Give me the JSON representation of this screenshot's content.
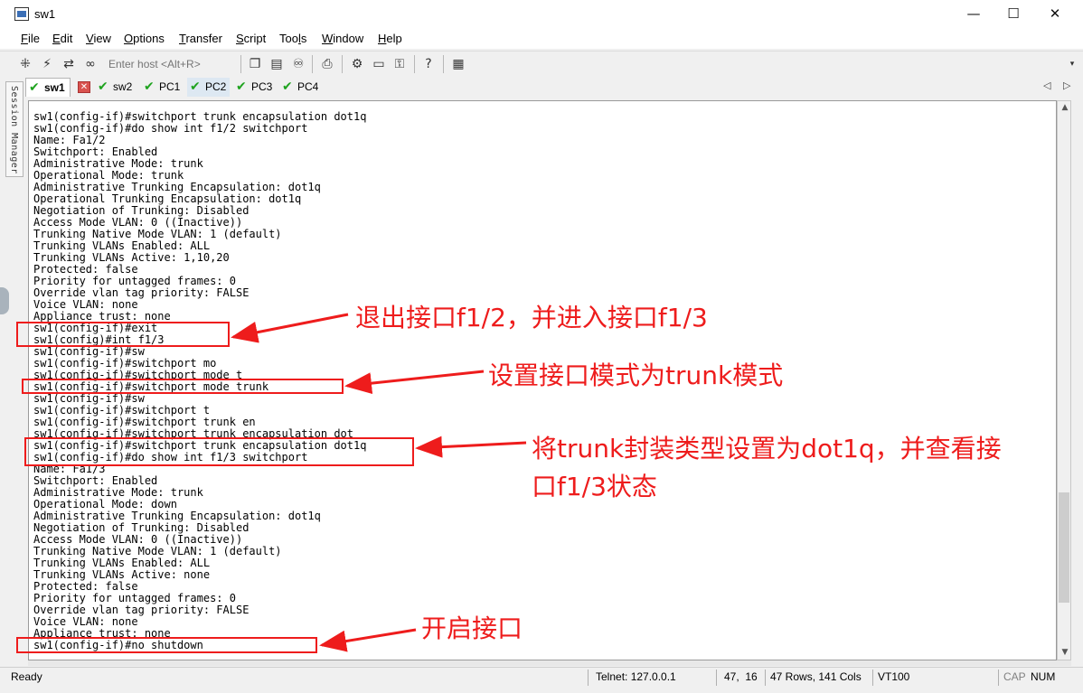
{
  "window": {
    "title": "sw1",
    "minimize_glyph": "—",
    "maximize_glyph": "☐",
    "close_glyph": "✕"
  },
  "menu": {
    "items": [
      {
        "accel": "F",
        "rest": "ile"
      },
      {
        "accel": "E",
        "rest": "dit"
      },
      {
        "accel": "V",
        "rest": "iew"
      },
      {
        "accel": "O",
        "rest": "ptions"
      },
      {
        "accel": "T",
        "rest": "ransfer"
      },
      {
        "accel": "S",
        "rest": "cript"
      },
      {
        "pre": "Too",
        "accel": "l",
        "rest": "s"
      },
      {
        "accel": "W",
        "rest": "indow"
      },
      {
        "accel": "H",
        "rest": "elp"
      }
    ]
  },
  "toolbar": {
    "host_placeholder": "Enter host <Alt+R>",
    "icons": [
      "connect-icon",
      "lightning-icon",
      "reconnect-icon",
      "link-icon",
      "copy-icon",
      "paste-icon",
      "find-icon",
      "print-icon",
      "settings-icon",
      "keymap-icon",
      "key-icon",
      "help-icon",
      "sftp-icon"
    ]
  },
  "tabs": [
    {
      "label": "sw1",
      "active": true
    },
    {
      "label": "sw2"
    },
    {
      "label": "PC1"
    },
    {
      "label": "PC2"
    },
    {
      "label": "PC3"
    },
    {
      "label": "PC4"
    }
  ],
  "session_manager": "Session Manager",
  "terminal": {
    "lines": [
      "sw1(config-if)#switchport trunk encapsulation dot1q",
      "sw1(config-if)#do show int f1/2 switchport",
      "Name: Fa1/2",
      "Switchport: Enabled",
      "Administrative Mode: trunk",
      "Operational Mode: trunk",
      "Administrative Trunking Encapsulation: dot1q",
      "Operational Trunking Encapsulation: dot1q",
      "Negotiation of Trunking: Disabled",
      "Access Mode VLAN: 0 ((Inactive))",
      "Trunking Native Mode VLAN: 1 (default)",
      "Trunking VLANs Enabled: ALL",
      "Trunking VLANs Active: 1,10,20",
      "Protected: false",
      "Priority for untagged frames: 0",
      "Override vlan tag priority: FALSE",
      "Voice VLAN: none",
      "Appliance trust: none",
      "sw1(config-if)#exit",
      "sw1(config)#int f1/3",
      "sw1(config-if)#sw",
      "sw1(config-if)#switchport mo",
      "sw1(config-if)#switchport mode t",
      "sw1(config-if)#switchport mode trunk",
      "sw1(config-if)#sw",
      "sw1(config-if)#switchport t",
      "sw1(config-if)#switchport trunk en",
      "sw1(config-if)#switchport trunk encapsulation dot",
      "sw1(config-if)#switchport trunk encapsulation dot1q",
      "sw1(config-if)#do show int f1/3 switchport",
      "Name: Fa1/3",
      "Switchport: Enabled",
      "Administrative Mode: trunk",
      "Operational Mode: down",
      "Administrative Trunking Encapsulation: dot1q",
      "Negotiation of Trunking: Disabled",
      "Access Mode VLAN: 0 ((Inactive))",
      "Trunking Native Mode VLAN: 1 (default)",
      "Trunking VLANs Enabled: ALL",
      "Trunking VLANs Active: none",
      "Protected: false",
      "Priority for untagged frames: 0",
      "Override vlan tag priority: FALSE",
      "Voice VLAN: none",
      "Appliance trust: none",
      "sw1(config-if)#no shutdown"
    ]
  },
  "annotations": {
    "exit_enter": "退出接口f1/2，并进入接口f1/3",
    "set_mode": "设置接口模式为trunk模式",
    "encap_line1": "将trunk封装类型设置为dot1q，并查看接",
    "encap_line2": "口f1/3状态",
    "enable": "开启接口",
    "color": "#ee1c1c"
  },
  "status": {
    "ready": "Ready",
    "telnet": "Telnet: 127.0.0.1",
    "cursor": "47,  16",
    "size": "47 Rows, 141 Cols",
    "emulation": "VT100",
    "cap": "CAP",
    "num": "NUM"
  }
}
